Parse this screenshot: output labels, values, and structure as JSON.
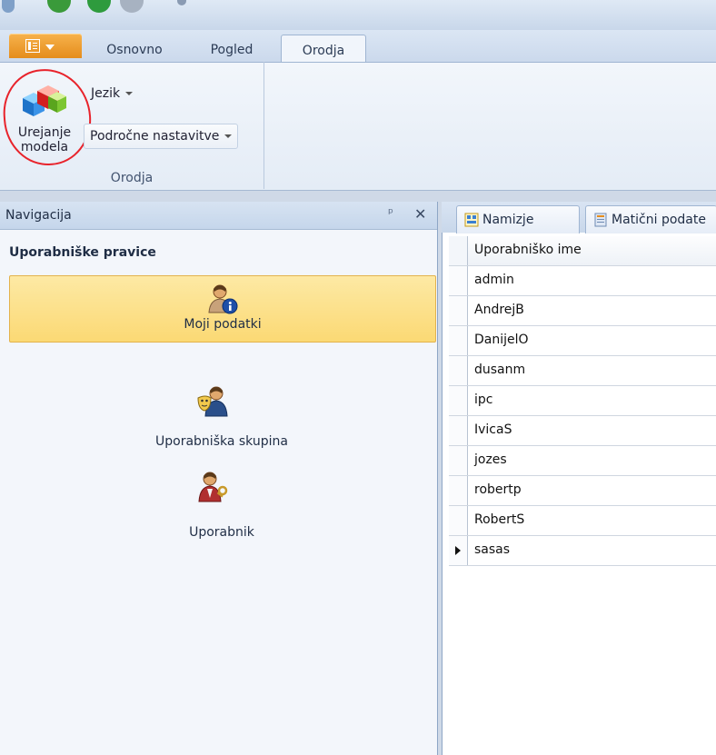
{
  "tabs": [
    "Osnovno",
    "Pogled",
    "Orodja"
  ],
  "active_tab": "Orodja",
  "ribbon": {
    "group_label": "Orodja",
    "urejanje_label": "Urejanje modela",
    "jezik_label": "Jezik",
    "podrocne_label": "Področne nastavitve"
  },
  "navigation": {
    "header": "Navigacija",
    "pin_glyph": "ᵖ",
    "close_glyph": "✕",
    "section_title": "Uporabniške pravice",
    "items": [
      {
        "label": "Moji podatki",
        "icon": "user-info-icon",
        "selected": true
      },
      {
        "label": "Uporabniška skupina",
        "icon": "user-group-masks-icon",
        "selected": false
      },
      {
        "label": "Uporabnik",
        "icon": "user-key-icon",
        "selected": false
      }
    ]
  },
  "document_tabs": [
    {
      "label": "Namizje",
      "icon": "desktop-icon"
    },
    {
      "label": "Matični podate",
      "icon": "data-icon"
    }
  ],
  "grid": {
    "column_header": "Uporabniško ime",
    "rows": [
      "admin",
      "AndrejB",
      "DanijelO",
      "dusanm",
      "ipc",
      "IvicaS",
      "jozes",
      "robertp",
      "RobertS",
      "sasas"
    ],
    "current_row": "sasas"
  },
  "colors": {
    "accent_orange": "#f2a23c",
    "selected_yellow": "#fbd974",
    "annotation_red": "#e8232b"
  }
}
